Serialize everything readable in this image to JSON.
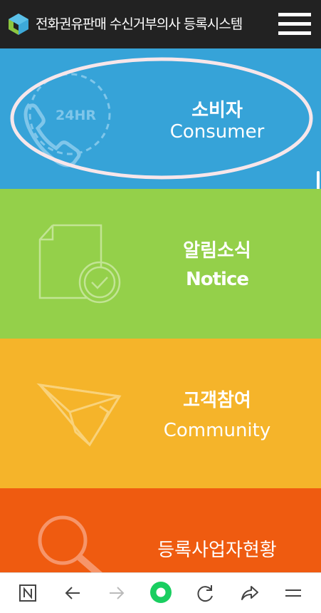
{
  "header": {
    "title": "전화권유판매 수신거부의사 등록시스템",
    "logo_icon": "cube-logo-icon",
    "menu_icon": "hamburger-menu-icon"
  },
  "tiles": [
    {
      "title_ko": "소비자",
      "title_en": "Consumer",
      "icon": "24hr-phone-icon",
      "icon_text": "24HR",
      "color": "#36A3D8"
    },
    {
      "title_ko": "알림소식",
      "title_en": "Notice",
      "icon": "document-check-icon",
      "color": "#94D04A"
    },
    {
      "title_ko": "고객참여",
      "title_en": "Community",
      "icon": "paper-plane-icon",
      "color": "#F5B42A"
    },
    {
      "title_ko": "등록사업자현황",
      "icon": "magnifier-icon",
      "color": "#EF5B10"
    }
  ],
  "bottom_bar": {
    "items": [
      "naver-n-icon",
      "back-arrow-icon",
      "forward-arrow-icon",
      "home-circle-icon",
      "refresh-icon",
      "share-icon",
      "menu-lines-icon"
    ]
  },
  "colors": {
    "header_bg": "#222222",
    "highlight_ellipse": "#F7E6EA",
    "home_green": "#19CE60"
  }
}
